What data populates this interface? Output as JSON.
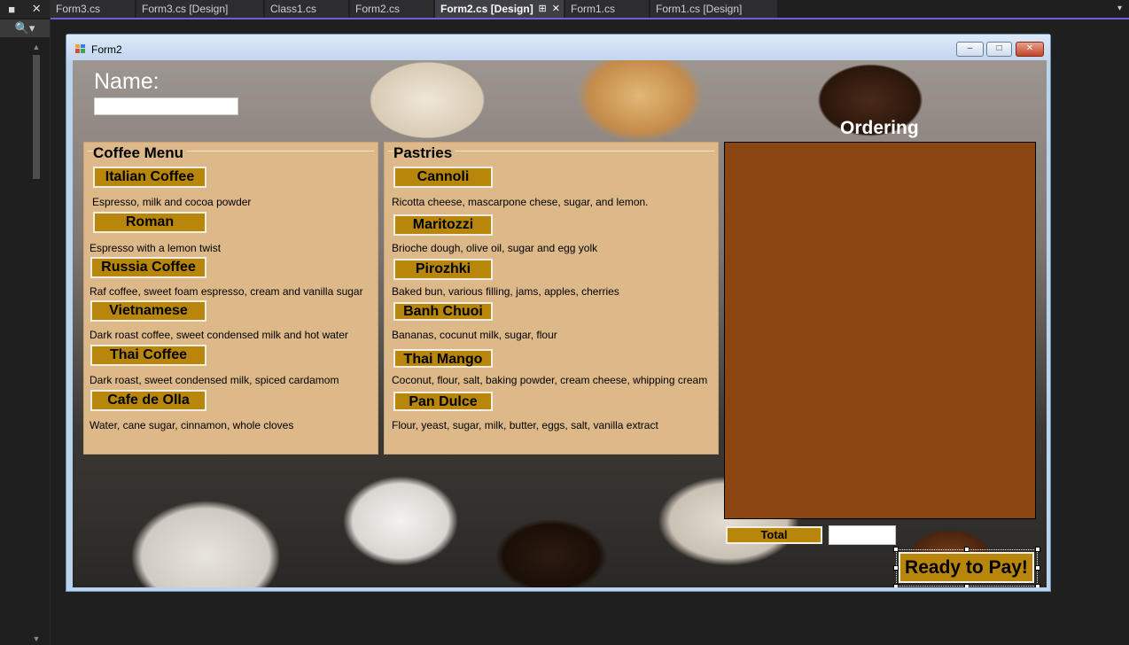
{
  "toolstrip": {
    "pin_label": "■",
    "pin_icon": "pin-icon",
    "close_label": "✕",
    "search_label": "🔍▾"
  },
  "tabs": [
    {
      "label": "Form3.cs"
    },
    {
      "label": "Form3.cs [Design]"
    },
    {
      "label": "Class1.cs"
    },
    {
      "label": "Form2.cs"
    },
    {
      "label": "Form2.cs [Design]",
      "active": true
    },
    {
      "label": "Form1.cs"
    },
    {
      "label": "Form1.cs [Design]"
    }
  ],
  "tab_menu_label": "▾",
  "form": {
    "title": "Form2",
    "minimize_label": "–",
    "maximize_label": "□",
    "close_label": "✕",
    "name_label": "Name:",
    "name_value": "",
    "coffee": {
      "title": "Coffee Menu",
      "items": [
        {
          "label": "Italian Coffee",
          "desc": "Espresso, milk and cocoa powder"
        },
        {
          "label": "Roman",
          "desc": "Espresso with a lemon twist"
        },
        {
          "label": "Russia Coffee",
          "desc": "Raf coffee, sweet foam espresso, cream and vanilla sugar"
        },
        {
          "label": "Vietnamese",
          "desc": "Dark roast coffee, sweet condensed milk and hot water"
        },
        {
          "label": "Thai Coffee",
          "desc": "Dark roast, sweet condensed milk, spiced cardamom"
        },
        {
          "label": "Cafe de Olla",
          "desc": "Water, cane sugar, cinnamon, whole cloves"
        }
      ]
    },
    "pastries": {
      "title": "Pastries",
      "items": [
        {
          "label": "Cannoli",
          "desc": "Ricotta cheese, mascarpone chese, sugar, and lemon."
        },
        {
          "label": "Maritozzi",
          "desc": "Brioche dough, olive oil, sugar and egg yolk"
        },
        {
          "label": "Pirozhki",
          "desc": "Baked bun, various filling, jams, apples, cherries"
        },
        {
          "label": "Banh Chuoi",
          "desc": "Bananas, cocunut milk, sugar, flour"
        },
        {
          "label": "Thai Mango",
          "desc": "Coconut, flour, salt, baking powder, cream cheese, whipping cream"
        },
        {
          "label": "Pan Dulce",
          "desc": "Flour, yeast, sugar, milk, butter, eggs, salt, vanilla extract"
        }
      ]
    },
    "ordering_label": "Ordering",
    "total_label": "Total",
    "total_value": "",
    "pay_label": "Ready to Pay!"
  },
  "colors": {
    "accent_gold": "#b8860b",
    "panel_tan": "#ddb888",
    "order_brown": "#8b4513",
    "tab_accent": "#7a5ad6"
  }
}
